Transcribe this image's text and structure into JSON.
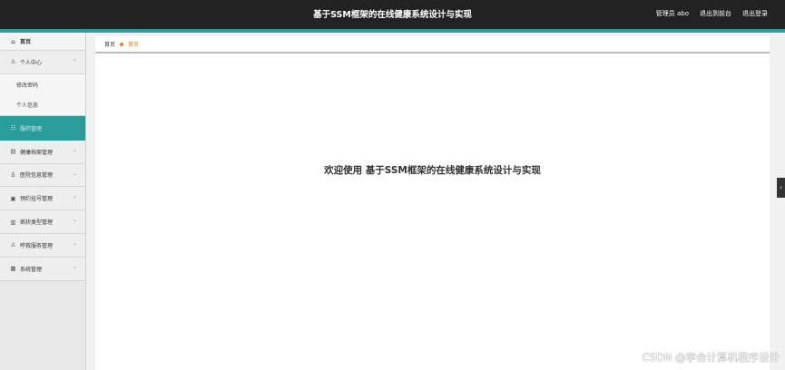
{
  "header": {
    "title": "基于SSM框架的在线健康系统设计与实现",
    "admin_label": "管理员 abo",
    "back_label": "退出到前台",
    "logout_label": "退出登录"
  },
  "sidebar": {
    "items": [
      {
        "label": "首页",
        "icon": "home-icon",
        "glyph": "⌂"
      },
      {
        "label": "个人中心",
        "icon": "user-icon",
        "glyph": "♙",
        "expanded": true,
        "sub": [
          {
            "label": "修改密码"
          },
          {
            "label": "个人信息"
          }
        ]
      },
      {
        "label": "服药管理",
        "icon": "users-icon",
        "glyph": "☷",
        "active": true
      },
      {
        "label": "健康档案管理",
        "icon": "file-icon",
        "glyph": "▤"
      },
      {
        "label": "医院信息管理",
        "icon": "hospital-icon",
        "glyph": "♁"
      },
      {
        "label": "预约挂号管理",
        "icon": "calendar-icon",
        "glyph": "▣"
      },
      {
        "label": "病状类型管理",
        "icon": "list-icon",
        "glyph": "▥"
      },
      {
        "label": "呼救服务管理",
        "icon": "person-icon",
        "glyph": "♙"
      },
      {
        "label": "系统管理",
        "icon": "settings-icon",
        "glyph": "▦"
      }
    ],
    "chevron": "⌄"
  },
  "breadcrumb": {
    "home": "首页",
    "current": "首页"
  },
  "main": {
    "welcome": "欢迎使用 基于SSM框架的在线健康系统设计与实现"
  },
  "edge_tab": {
    "glyph": "‹"
  },
  "watermark": "CSDN @李会计算机程序设计",
  "colors": {
    "accent": "#2a9d9a",
    "topbar": "#222222",
    "breadcrumb_current": "#e67e22"
  }
}
